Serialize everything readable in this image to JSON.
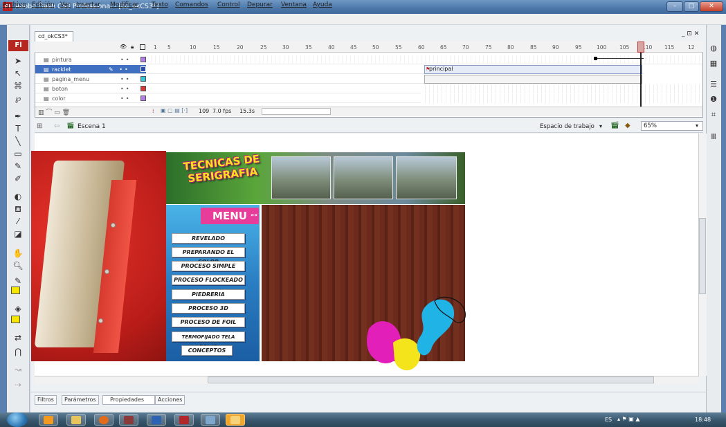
{
  "window": {
    "title": "Adobe Flash CS3 Professional - [cd_okCS3*]",
    "app_icon": "Fl",
    "controls": [
      "minimize",
      "maximize",
      "close"
    ]
  },
  "menubar": [
    "Archivo",
    "Edición",
    "Ver",
    "Insertar",
    "Modificar",
    "Texto",
    "Comandos",
    "Control",
    "Depurar",
    "Ventana",
    "Ayuda"
  ],
  "document": {
    "tab": "cd_okCS3*",
    "window_controls": "_ ⊡ ✕"
  },
  "timeline": {
    "frame_numbers": [
      "1",
      "5",
      "10",
      "15",
      "20",
      "25",
      "30",
      "35",
      "40",
      "45",
      "50",
      "55",
      "60",
      "65",
      "70",
      "75",
      "80",
      "85",
      "90",
      "95",
      "100",
      "105",
      "110",
      "115",
      "12"
    ],
    "layers": [
      {
        "name": "pintura",
        "color": "#b47ee6"
      },
      {
        "name": "racklet",
        "color": "#2c4ea8",
        "selected": true
      },
      {
        "name": "pagina_menu",
        "color": "#31c7d6"
      },
      {
        "name": "boton",
        "color": "#d33a3a"
      },
      {
        "name": "color",
        "color": "#b47ee6"
      }
    ],
    "frame_label": "principal",
    "current_frame": "109",
    "fps": "7.0 fps",
    "time": "15.3s"
  },
  "scene": {
    "name": "Escena 1",
    "workspace_label": "Espacio de trabajo",
    "zoom": "65%"
  },
  "stage": {
    "logo_text": "TECNICAS DE SERIGRAFIA",
    "menu_title": "MENU",
    "menu_buttons": [
      "REVELADO",
      "PREPARANDO EL COLOR",
      "PROCESO SIMPLE",
      "PROCESO FLOCKEADO",
      "PIEDRERIA",
      "PROCESO 3D",
      "PROCESO DE FOIL",
      "TERMOFIJADO TELA POLAR",
      "CONCEPTOS"
    ]
  },
  "panels": {
    "tabs": [
      "Filtros",
      "Parámetros",
      "Propiedades",
      "Acciones"
    ]
  },
  "taskbar": {
    "lang": "ES",
    "clock": "18:48"
  },
  "colors": {
    "title_bar": "#4b77a8",
    "selected_layer": "#3f6fc0",
    "flash_red": "#b5271f",
    "menu_pink": "#e73c9a"
  }
}
